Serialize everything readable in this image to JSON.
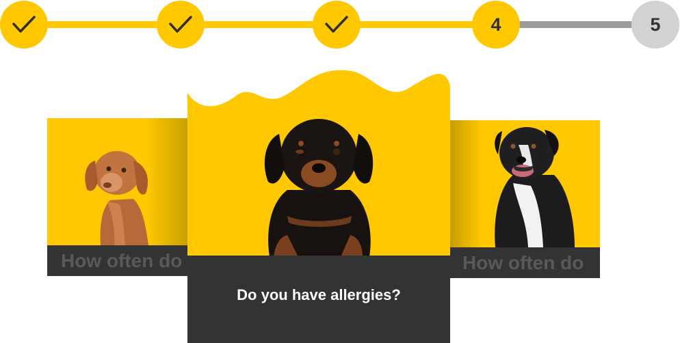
{
  "stepper": {
    "steps": [
      {
        "state": "completed",
        "icon": "check-icon",
        "label": ""
      },
      {
        "state": "completed",
        "icon": "check-icon",
        "label": ""
      },
      {
        "state": "completed",
        "icon": "check-icon",
        "label": ""
      },
      {
        "state": "current",
        "label": "4"
      },
      {
        "state": "upcoming",
        "label": "5"
      }
    ],
    "colors": {
      "active": "#FFC800",
      "inactive": "#D2D2D2",
      "track_inactive": "#9B9B9B"
    }
  },
  "cards": {
    "left": {
      "question": "How often do",
      "image": "vizsla-dog"
    },
    "center": {
      "question": "Do you have allergies?",
      "image": "rottweiler-puppy"
    },
    "right": {
      "question": "How often do",
      "image": "border-collie-dog"
    }
  },
  "colors": {
    "card_bg": "#FFC800",
    "caption_bg": "#333333",
    "caption_text": "#FFFFFF"
  }
}
